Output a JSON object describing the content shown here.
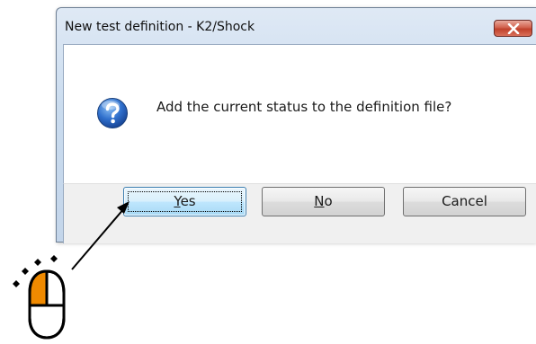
{
  "dialog": {
    "title": "New test definition - K2/Shock",
    "message": "Add the current status to the definition file?",
    "icon": "question-icon",
    "close_icon": "close-icon"
  },
  "buttons": {
    "yes": {
      "mnemonic": "Y",
      "rest": "es"
    },
    "no": {
      "mnemonic": "N",
      "rest": "o"
    },
    "cancel": "Cancel"
  },
  "annotation": {
    "pointer": "arrow-icon",
    "mouse": "mouse-click-icon",
    "mouse_left_button_color": "#f08a00"
  }
}
